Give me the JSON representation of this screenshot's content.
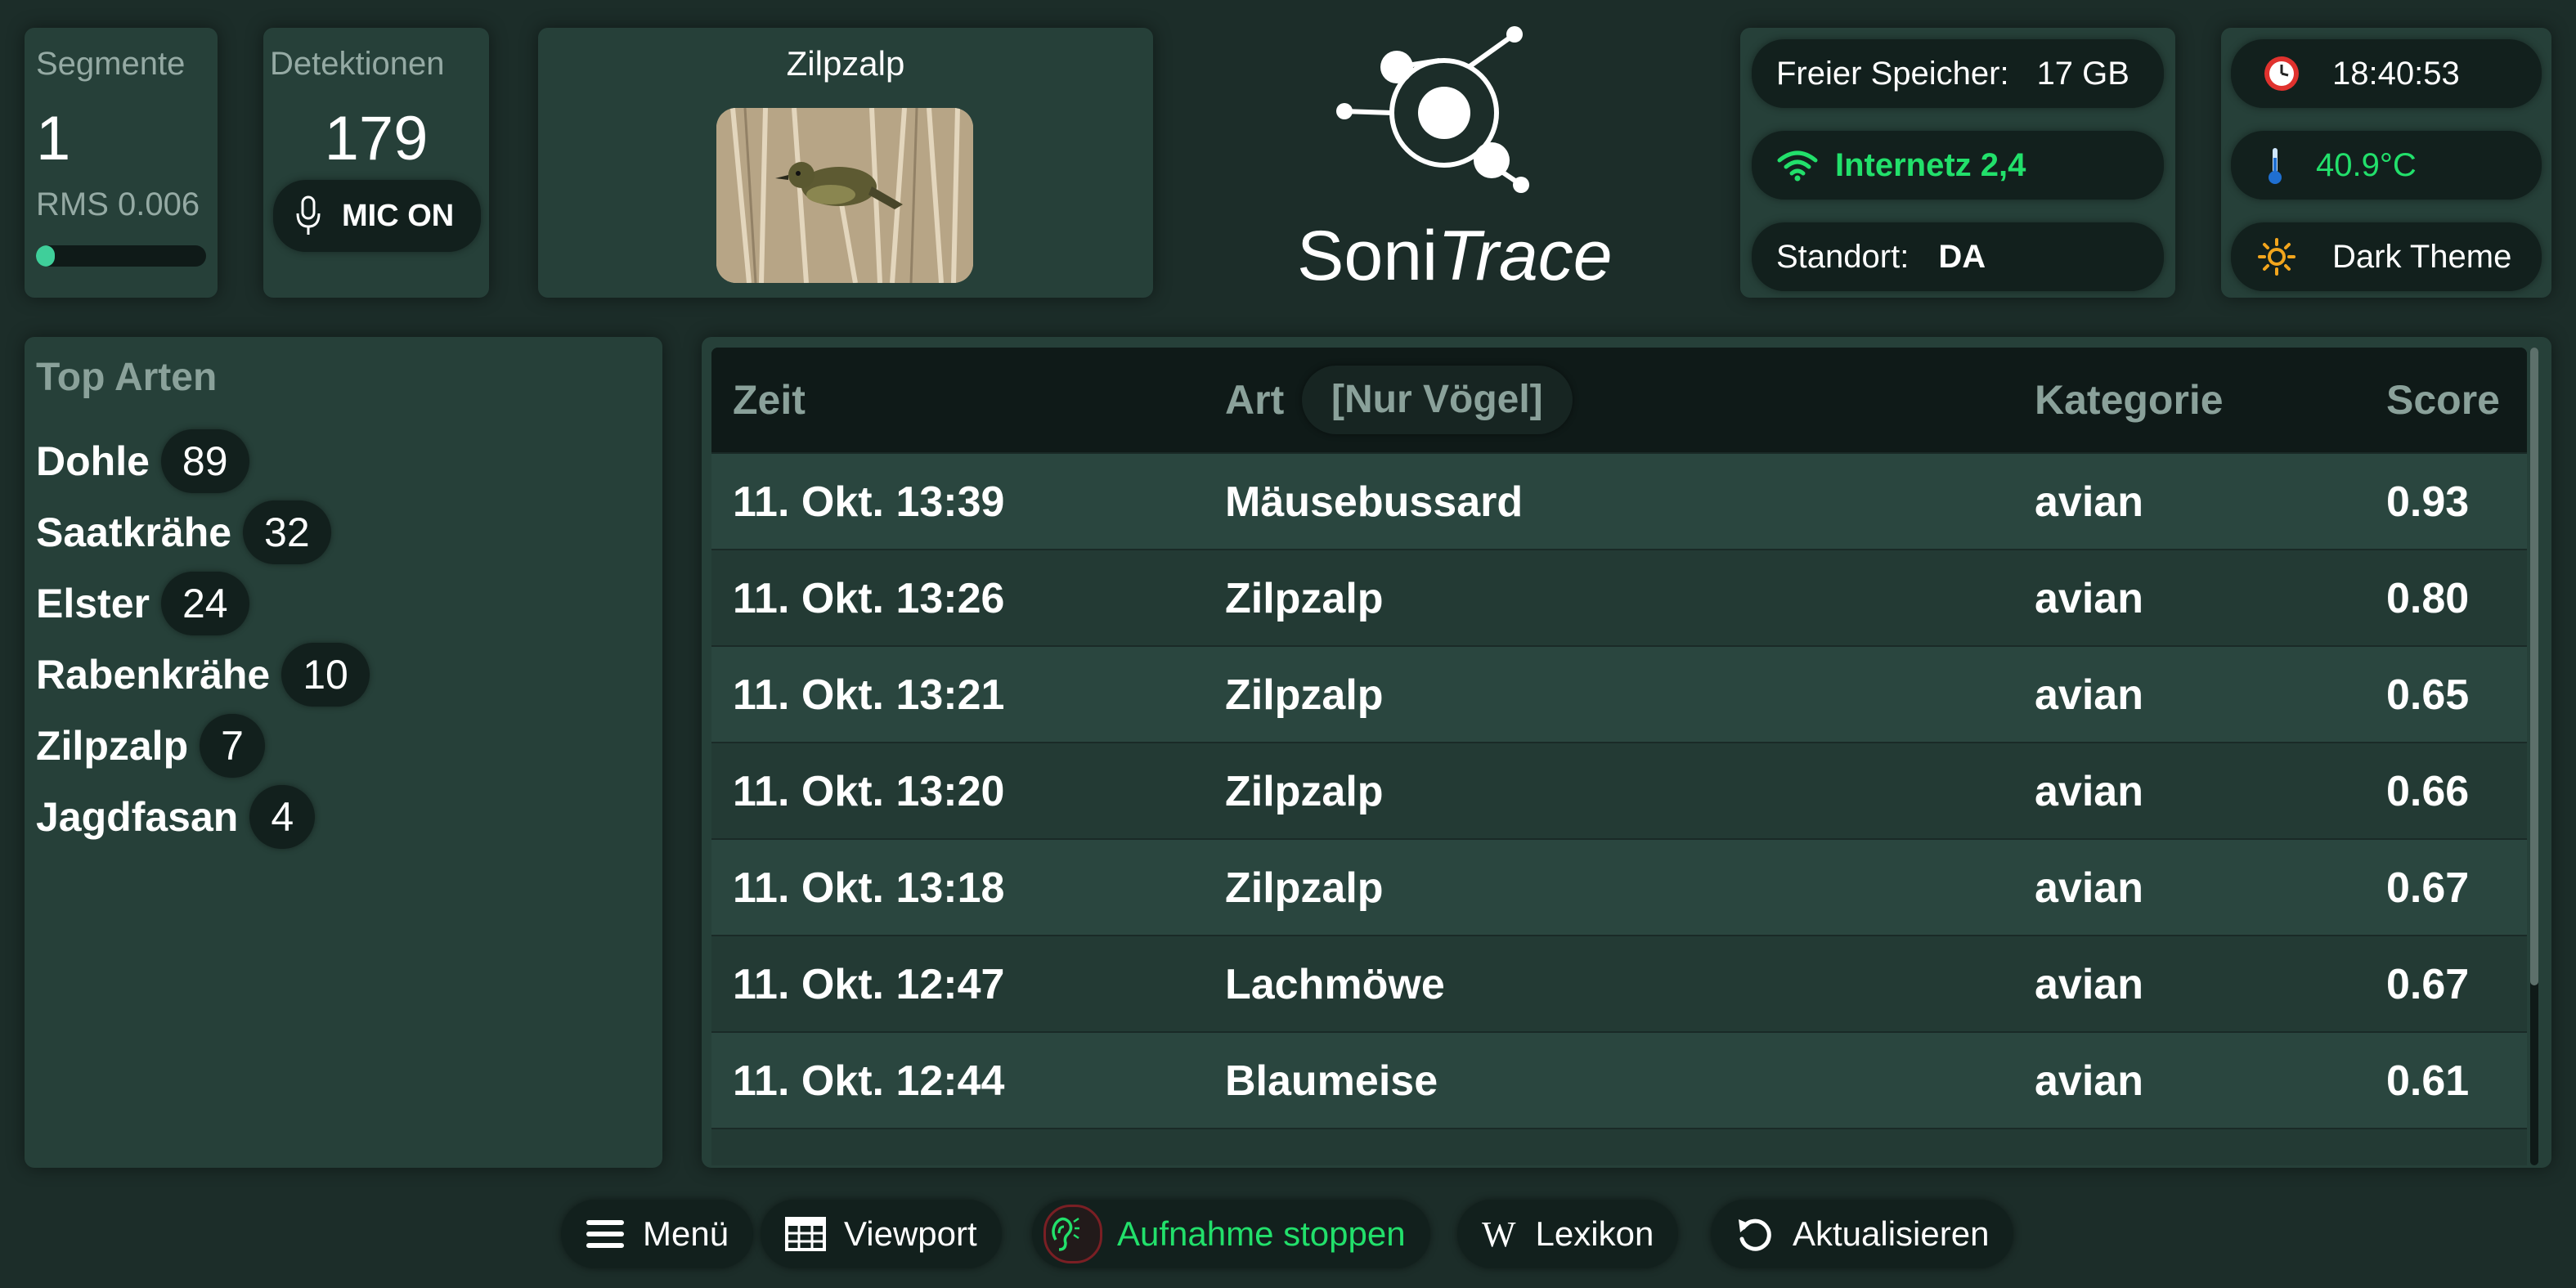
{
  "stats": {
    "segments_label": "Segmente",
    "segments_value": "1",
    "rms_label": "RMS 0.006",
    "rms_level": 0.11,
    "detections_label": "Detektionen",
    "detections_value": "179",
    "mic_label": "MIC ON"
  },
  "current_bird": {
    "name": "Zilpzalp"
  },
  "logo": {
    "part1": "Soni",
    "part2": "Trace"
  },
  "system": {
    "storage_label": "Freier Speicher:",
    "storage_value": "17 GB",
    "internet_label": "Internetz 2,4",
    "location_label": "Standort:",
    "location_value": "DA",
    "time": "18:40:53",
    "temperature": "40.9°C",
    "theme_label": "Dark Theme"
  },
  "top_species": {
    "title": "Top Arten",
    "items": [
      {
        "name": "Dohle",
        "count": "89"
      },
      {
        "name": "Saatkrähe",
        "count": "32"
      },
      {
        "name": "Elster",
        "count": "24"
      },
      {
        "name": "Rabenkrähe",
        "count": "10"
      },
      {
        "name": "Zilpzalp",
        "count": "7"
      },
      {
        "name": "Jagdfasan",
        "count": "4"
      }
    ]
  },
  "table": {
    "headers": {
      "time": "Zeit",
      "species": "Art",
      "filter": "[Nur Vögel]",
      "category": "Kategorie",
      "score": "Score"
    },
    "rows": [
      {
        "time": "11. Okt. 13:39",
        "species": "Mäusebussard",
        "category": "avian",
        "score": "0.93"
      },
      {
        "time": "11. Okt. 13:26",
        "species": "Zilpzalp",
        "category": "avian",
        "score": "0.80"
      },
      {
        "time": "11. Okt. 13:21",
        "species": "Zilpzalp",
        "category": "avian",
        "score": "0.65"
      },
      {
        "time": "11. Okt. 13:20",
        "species": "Zilpzalp",
        "category": "avian",
        "score": "0.66"
      },
      {
        "time": "11. Okt. 13:18",
        "species": "Zilpzalp",
        "category": "avian",
        "score": "0.67"
      },
      {
        "time": "11. Okt. 12:47",
        "species": "Lachmöwe",
        "category": "avian",
        "score": "0.67"
      },
      {
        "time": "11. Okt. 12:44",
        "species": "Blaumeise",
        "category": "avian",
        "score": "0.61"
      }
    ]
  },
  "bottom_bar": {
    "menu": "Menü",
    "viewport": "Viewport",
    "record": "Aufnahme stoppen",
    "lexicon": "Lexikon",
    "refresh": "Aktualisieren"
  },
  "colors": {
    "accent_green": "#22e06b",
    "background": "#1c2d29",
    "card": "#264039",
    "pill": "#12201d"
  },
  "icons": [
    "mic-icon",
    "wifi-icon",
    "clock-icon",
    "thermometer-icon",
    "sun-icon",
    "menu-icon",
    "table-icon",
    "ear-icon",
    "wikipedia-icon",
    "refresh-icon"
  ]
}
